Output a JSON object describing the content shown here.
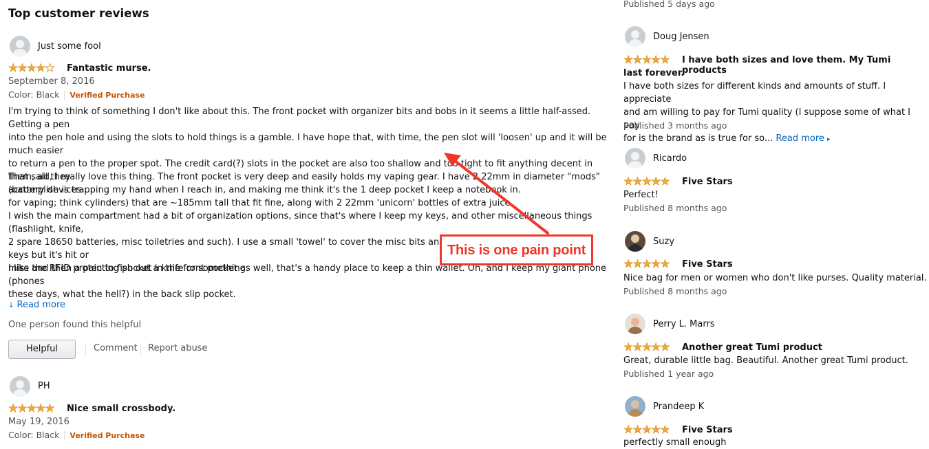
{
  "section_title": "Top customer reviews",
  "main_reviews": [
    {
      "author": "Just some fool",
      "rating": 4,
      "title": "Fantastic murse.",
      "date": "September 8, 2016",
      "color": "Color: Black",
      "verified": "Verified Purchase",
      "paragraphs": [
        [
          "I'm trying to think of something I don't like about this. The front pocket with organizer bits and bobs in it seems a little half-assed. Getting a pen",
          "into the pen hole and using the slots to hold things is a gamble. I have hope that, with time, the pen slot will 'loosen' up and it will be much easier",
          "to return a pen to the proper spot. The credit card(?) slots in the pocket are also too shallow and too tight to fit anything decent in them, all they",
          "accomplish is trapping my hand when I reach in, and making me think it's the 1 deep pocket I keep a notebook in."
        ],
        [
          "That said, I really love this thing. The front pocket is very deep and easily holds my vaping gear. I have 2 22mm in diameter \"mods\" (battery devices",
          "for vaping; think cylinders) that are ~185mm tall that fit fine, along with 2 22mm 'unicorn' bottles of extra juice."
        ],
        [
          "I wish the main compartment had a bit of organization options, since that's where I keep my keys, and other miscellaneous things (flashlight, knife,",
          "2 spare 18650 batteries, misc toiletries and such). I use a small 'towel' to cover the misc bits and bobs and provide a shelf for my keys but it's hit or",
          "miss and then a pain to fish out a knife or something."
        ],
        [
          "I like the RFID protecting pocket in the front pocket as well, that's a handy place to keep a thin wallet. Oh, and I keep my giant phone (phones",
          "these days, what the hell?) in the back slip pocket."
        ]
      ],
      "read_more": "Read more",
      "helpful_count": "One person found this helpful",
      "helpful_button": "Helpful",
      "comment": "Comment",
      "report": "Report abuse"
    },
    {
      "author": "PH",
      "rating": 5,
      "title": "Nice small crossbody.",
      "date": "May 19, 2016",
      "color": "Color: Black",
      "verified": "Verified Purchase"
    }
  ],
  "side_top_published": "Published 5 days ago",
  "side_reviews": [
    {
      "author": "Doug Jensen",
      "rating": 5,
      "title_lines": [
        "I have both sizes and love them. My Tumi products",
        "last forever."
      ],
      "text_lines": [
        "I have both sizes for different kinds and amounts of stuff. I appreciate",
        "and am willing to pay for Tumi quality (I suppose some of what I pay",
        "for is the brand as is true for so..."
      ],
      "read_more": "Read more",
      "published": "Published 3 months ago"
    },
    {
      "author": "Ricardo",
      "rating": 5,
      "title_lines": [
        "Five Stars"
      ],
      "text_lines": [
        "Perfect!"
      ],
      "published": "Published 8 months ago"
    },
    {
      "author": "Suzy",
      "rating": 5,
      "title_lines": [
        "Five Stars"
      ],
      "text_lines": [
        "Nice bag for men or women who don't like purses. Quality material."
      ],
      "published": "Published 8 months ago"
    },
    {
      "author": "Perry L. Marrs",
      "rating": 5,
      "title_lines": [
        "Another great Tumi product"
      ],
      "text_lines": [
        "Great, durable little bag. Beautiful. Another great Tumi product."
      ],
      "published": "Published 1 year ago"
    },
    {
      "author": "Prandeep K",
      "rating": 5,
      "title_lines": [
        "Five Stars"
      ],
      "text_lines": [
        "perfectly small enough"
      ]
    }
  ],
  "annotation": {
    "text": "This is one pain point",
    "color": "#f0362a"
  },
  "colors": {
    "star": "#f2a93b",
    "verified": "#c45500",
    "link": "#0066c0"
  }
}
